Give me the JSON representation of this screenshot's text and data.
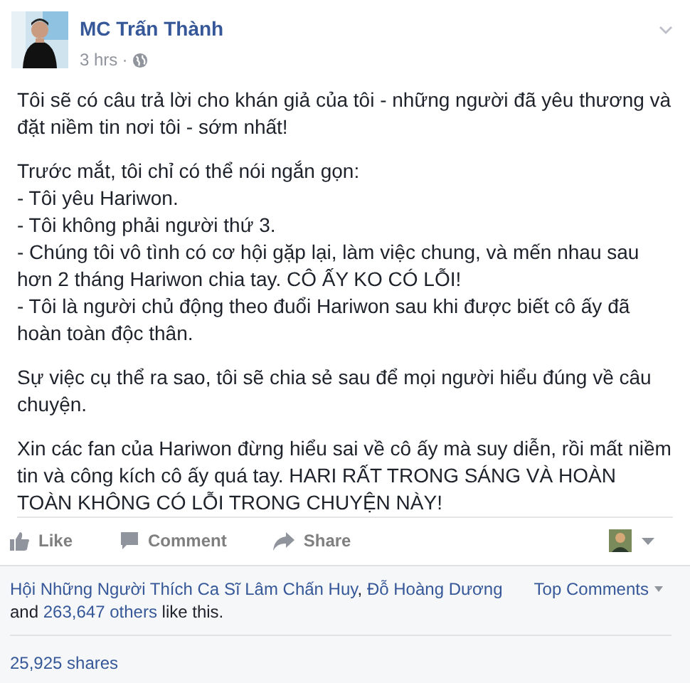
{
  "post": {
    "author": "MC Trấn Thành",
    "time": "3 hrs",
    "separator": "·",
    "paragraphs": [
      {
        "lines": [
          "Tôi sẽ có câu trả lời cho khán giả của tôi - những người đã yêu thương và đặt niềm tin nơi tôi - sớm nhất!"
        ]
      },
      {
        "lines": [
          "Trước mắt, tôi chỉ có thể nói ngắn gọn:",
          "- Tôi yêu Hariwon.",
          "- Tôi không phải người thứ 3.",
          "- Chúng tôi vô tình có cơ hội gặp lại, làm việc chung, và mến nhau sau hơn 2 tháng Hariwon chia tay. CÔ ẤY KO CÓ LỖI!",
          "- Tôi là người chủ động theo đuổi Hariwon sau khi được biết cô ấy đã hoàn toàn độc thân."
        ]
      },
      {
        "lines": [
          "Sự việc cụ thể ra sao, tôi sẽ chia sẻ sau để mọi người hiểu đúng về câu chuyện."
        ]
      },
      {
        "lines": [
          "Xin các fan của Hariwon đừng hiểu sai về cô ấy mà suy diễn, rồi mất niềm tin và công kích cô ấy quá tay. HARI RẤT TRONG SÁNG VÀ HOÀN TOÀN KHÔNG CÓ LỖI TRONG CHUYỆN NÀY!"
        ]
      }
    ]
  },
  "actions": [
    {
      "label": "Like",
      "kind": "like"
    },
    {
      "label": "Comment",
      "kind": "comment"
    },
    {
      "label": "Share",
      "kind": "share"
    }
  ],
  "likes": {
    "parts": [
      {
        "kind": "link",
        "text": "Hội Những Người Thích Ca Sĩ Lâm Chấn Huy"
      },
      {
        "kind": "text",
        "text": ","
      },
      {
        "kind": "link",
        "text": "Đỗ Hoàng Dương"
      },
      {
        "kind": "text",
        "text": "and"
      },
      {
        "kind": "link",
        "text": "263,647 others"
      },
      {
        "kind": "text",
        "text": "like this."
      }
    ]
  },
  "sort": {
    "label": "Top Comments"
  },
  "shares": "25,925 shares"
}
